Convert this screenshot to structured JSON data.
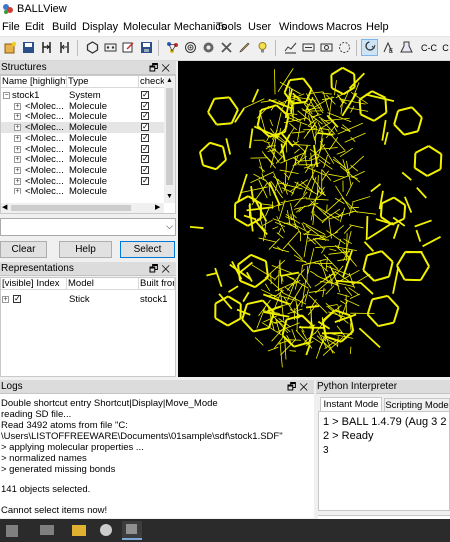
{
  "window": {
    "title": "BALLView"
  },
  "menu": [
    "File",
    "Edit",
    "Build",
    "Display",
    "Molecular Mechanics",
    "Tools",
    "User",
    "Windows",
    "Macros",
    "Help"
  ],
  "toolbar_icons": [
    "new-icon",
    "save-icon",
    "split-icon",
    "merge-icon",
    "ring-icon",
    "select-icon",
    "edit-icon",
    "save2-icon",
    "molecule-icon",
    "target-icon",
    "settings-icon",
    "tools-icon",
    "pen-icon",
    "bulb-icon",
    "graph-icon",
    "zoom-icon",
    "refresh-icon",
    "rotate-icon",
    "element-icon",
    "bond-icon",
    "angle-icon",
    "clear-icon"
  ],
  "structures": {
    "title": "Structures",
    "headers": [
      "Name [highlight]",
      "Type",
      "check"
    ],
    "root": {
      "name": "stock1",
      "type": "System"
    },
    "items": [
      {
        "name": "<Molec...",
        "type": "Molecule"
      },
      {
        "name": "<Molec...",
        "type": "Molecule"
      },
      {
        "name": "<Molec...",
        "type": "Molecule"
      },
      {
        "name": "<Molec...",
        "type": "Molecule"
      },
      {
        "name": "<Molec...",
        "type": "Molecule"
      },
      {
        "name": "<Molec...",
        "type": "Molecule"
      },
      {
        "name": "<Molec...",
        "type": "Molecule"
      },
      {
        "name": "<Molec...",
        "type": "Molecule"
      },
      {
        "name": "<Molec...",
        "type": "Molecule"
      }
    ],
    "buttons": {
      "clear": "Clear",
      "help": "Help",
      "select": "Select"
    }
  },
  "representations": {
    "title": "Representations",
    "headers": [
      "[visible] Index",
      "Model",
      "Built from"
    ],
    "rows": [
      {
        "model": "Stick",
        "built_from": "stock1"
      }
    ]
  },
  "logs": {
    "title": "Logs",
    "lines": [
      "Double shortcut entry Shortcut|Display|Move_Mode",
      "reading SD file...",
      "Read 3492 atoms from file \"C:",
      "\\Users\\LISTOFFREEWARE\\Documents\\01sample\\sdf\\stock1.SDF\"",
      "> applying molecular properties ...",
      "  > normalized names",
      "  > generated missing bonds",
      "",
      "141 objects selected.",
      "",
      "Cannot select items now!"
    ]
  },
  "python": {
    "title": "Python Interpreter",
    "tabs": [
      "Instant Mode",
      "Scripting Mode"
    ],
    "lines": [
      "1 > BALL 1.4.79 (Aug  3 2",
      "2 > Ready",
      "3"
    ]
  },
  "colors": {
    "molecule": "#f2f200",
    "viewer_bg": "#000000",
    "taskbar": "#2b2b2b"
  }
}
